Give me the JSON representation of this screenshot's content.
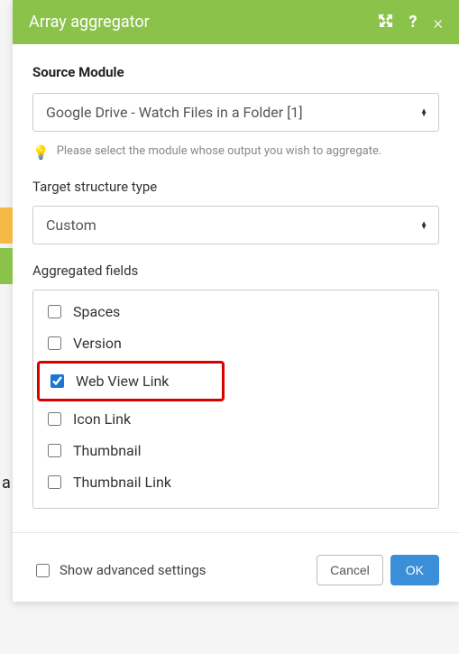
{
  "header": {
    "title": "Array aggregator"
  },
  "source": {
    "label": "Source Module",
    "value": "Google Drive - Watch Files in a Folder [1]",
    "hint": "Please select the module whose output you wish to aggregate."
  },
  "targetType": {
    "label": "Target structure type",
    "value": "Custom"
  },
  "aggregated": {
    "label": "Aggregated fields",
    "fields": [
      {
        "label": "Spaces",
        "checked": false,
        "highlight": false
      },
      {
        "label": "Version",
        "checked": false,
        "highlight": false
      },
      {
        "label": "Web View Link",
        "checked": true,
        "highlight": true
      },
      {
        "label": "Icon Link",
        "checked": false,
        "highlight": false
      },
      {
        "label": "Thumbnail",
        "checked": false,
        "highlight": false
      },
      {
        "label": "Thumbnail Link",
        "checked": false,
        "highlight": false
      }
    ]
  },
  "footer": {
    "advanced": "Show advanced settings",
    "cancel": "Cancel",
    "ok": "OK"
  }
}
